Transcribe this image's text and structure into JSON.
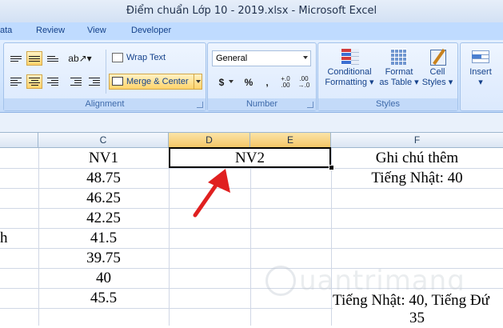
{
  "window": {
    "title": "Điểm chuẩn Lớp 10 - 2019.xlsx - Microsoft Excel"
  },
  "ribbon_tabs": [
    "ata",
    "Review",
    "View",
    "Developer"
  ],
  "alignment": {
    "wrap_text": "Wrap Text",
    "merge_center": "Merge & Center",
    "group_label": "Alignment"
  },
  "number": {
    "format_value": "General",
    "currency": "$",
    "percent": "%",
    "comma": ",",
    "inc_decimal": "+.0 .00",
    "dec_decimal": ".00 →.0",
    "group_label": "Number"
  },
  "styles": {
    "conditional_formatting": [
      "Conditional",
      "Formatting"
    ],
    "format_as_table": [
      "Format",
      "as Table"
    ],
    "cell_styles": [
      "Cell",
      "Styles"
    ],
    "group_label": "Styles"
  },
  "cells": {
    "insert": "Insert"
  },
  "columns": [
    "C",
    "D",
    "E",
    "F"
  ],
  "sheet": {
    "c_header": "NV1",
    "de_merged": "NV2",
    "f_header": "Ghi chú thêm",
    "c_values": [
      "48.75",
      "46.25",
      "42.25",
      "41.5",
      "39.75",
      "40",
      "45.5"
    ],
    "a_partial": "h",
    "f_row2": "Tiếng Nhật: 40",
    "f_row8": "Tiếng Nhật: 40, Tiếng Đứ",
    "f_row9": "35"
  },
  "watermark": "uantrimang",
  "colors": {
    "selection_header": "#f4c667",
    "arrow": "#e02020",
    "ribbon_text": "#15428b"
  }
}
